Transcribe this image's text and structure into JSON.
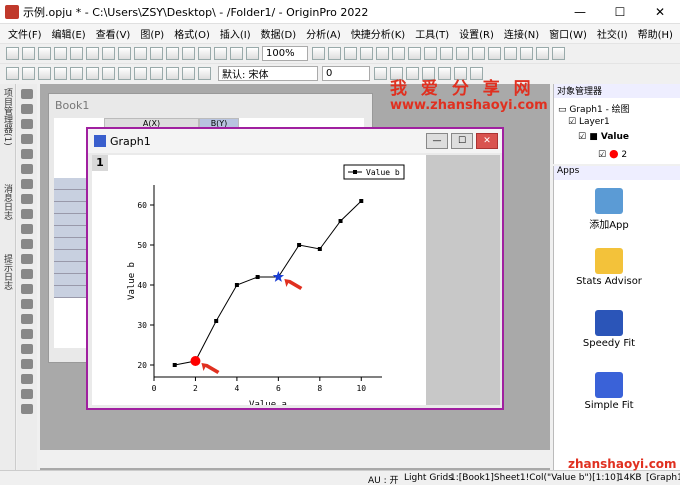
{
  "window": {
    "title": "示例.opju * - C:\\Users\\ZSY\\Desktop\\ - /Folder1/ - OriginPro 2022",
    "min": "—",
    "max": "☐",
    "close": "✕"
  },
  "menu": [
    "文件(F)",
    "编辑(E)",
    "查看(V)",
    "图(P)",
    "格式(O)",
    "插入(I)",
    "数据(D)",
    "分析(A)",
    "快捷分析(K)",
    "工具(T)",
    "设置(R)",
    "连接(N)",
    "窗口(W)",
    "社交(I)",
    "帮助(H)"
  ],
  "toolbar": {
    "zoom": "100%",
    "font": "默认: 宋体",
    "size": "0"
  },
  "left_tabs": [
    "项目管理器(1)",
    "消息日志",
    "提示日志"
  ],
  "book": {
    "title": "Book1",
    "col_a": "A(X)",
    "col_b": "B(Y)"
  },
  "graph": {
    "title": "Graph1",
    "layer": "1",
    "legend": "Value b",
    "annotations": {
      "arrow_color": "#e03020",
      "red_point_color": "#ff0000",
      "blue_star_color": "#1a3fd6"
    }
  },
  "chart_data": {
    "type": "line",
    "title": "",
    "xlabel": "Value a",
    "ylabel": "Value b",
    "xlim": [
      0,
      11
    ],
    "ylim": [
      17,
      65
    ],
    "xticks": [
      0,
      2,
      4,
      6,
      8,
      10
    ],
    "yticks": [
      20,
      30,
      40,
      50,
      60
    ],
    "grid": false,
    "legend_position": "top-right",
    "series": [
      {
        "name": "Value b",
        "x": [
          1,
          2,
          3,
          4,
          5,
          6,
          7,
          8,
          9,
          10
        ],
        "y": [
          20,
          21,
          31,
          40,
          42,
          42,
          50,
          49,
          56,
          61
        ]
      }
    ],
    "highlight": [
      {
        "x": 2,
        "y": 21,
        "marker": "circle",
        "color": "#ff0000"
      },
      {
        "x": 6,
        "y": 42,
        "marker": "star",
        "color": "#1a3fd6"
      }
    ]
  },
  "object_manager": {
    "header": "对象管理器",
    "graph": "Graph1 - 绘图",
    "layer": "Layer1",
    "plot": "Value",
    "plot_index": "2"
  },
  "apps": {
    "header": "Apps",
    "items": [
      "添加App",
      "Stats Advisor",
      "Speedy Fit",
      "Simple Fit"
    ]
  },
  "status": {
    "au": "AU : 开",
    "grid": "Light Grids",
    "sel": "1:[Book1]Sheet1!Col(\"Value b\")[1:10]",
    "size": "14KB",
    "graph": "[Graph1"
  },
  "watermark": {
    "line1": "我 爱 分 享 网",
    "line2": "www.zhanshaoyi.com",
    "line3": "zhanshaoyi.com"
  }
}
